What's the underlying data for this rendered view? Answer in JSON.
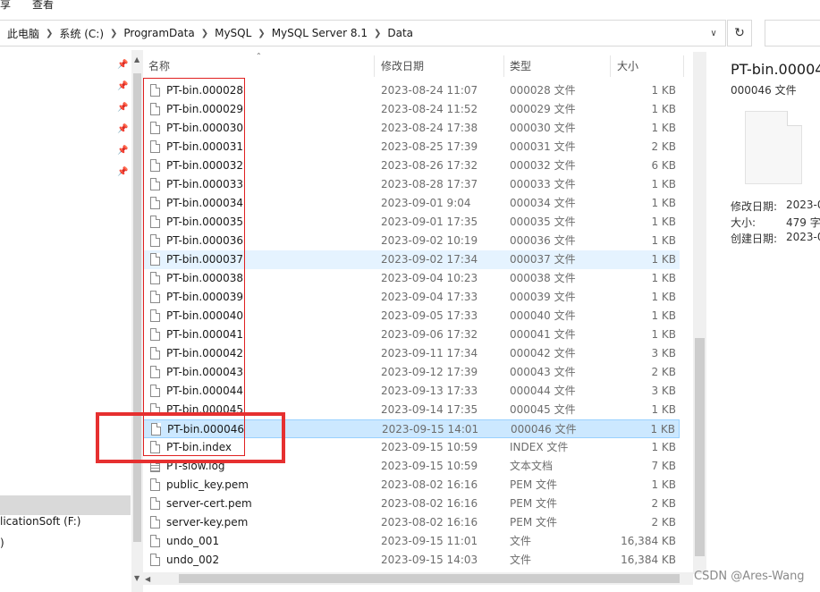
{
  "ribbon": {
    "item_left": "享",
    "item_view": "查看"
  },
  "breadcrumb": [
    "此电脑",
    "系统 (C:)",
    "ProgramData",
    "MySQL",
    "MySQL Server 8.1",
    "Data"
  ],
  "nav": {
    "drive_label": "licationSoft (F:)",
    "drive_label_2": ")"
  },
  "columns": {
    "name": "名称",
    "date": "修改日期",
    "type": "类型",
    "size": "大小"
  },
  "files": [
    {
      "name": "PT-bin.000028",
      "date": "2023-08-24 11:07",
      "type": "000028 文件",
      "size": "1 KB",
      "icon": "file-icon"
    },
    {
      "name": "PT-bin.000029",
      "date": "2023-08-24 11:52",
      "type": "000029 文件",
      "size": "1 KB",
      "icon": "file-icon"
    },
    {
      "name": "PT-bin.000030",
      "date": "2023-08-24 17:38",
      "type": "000030 文件",
      "size": "1 KB",
      "icon": "file-icon"
    },
    {
      "name": "PT-bin.000031",
      "date": "2023-08-25 17:39",
      "type": "000031 文件",
      "size": "2 KB",
      "icon": "file-icon"
    },
    {
      "name": "PT-bin.000032",
      "date": "2023-08-26 17:32",
      "type": "000032 文件",
      "size": "6 KB",
      "icon": "file-icon"
    },
    {
      "name": "PT-bin.000033",
      "date": "2023-08-28 17:37",
      "type": "000033 文件",
      "size": "1 KB",
      "icon": "file-icon"
    },
    {
      "name": "PT-bin.000034",
      "date": "2023-09-01 9:04",
      "type": "000034 文件",
      "size": "1 KB",
      "icon": "file-icon"
    },
    {
      "name": "PT-bin.000035",
      "date": "2023-09-01 17:35",
      "type": "000035 文件",
      "size": "1 KB",
      "icon": "file-icon"
    },
    {
      "name": "PT-bin.000036",
      "date": "2023-09-02 10:19",
      "type": "000036 文件",
      "size": "1 KB",
      "icon": "file-icon"
    },
    {
      "name": "PT-bin.000037",
      "date": "2023-09-02 17:34",
      "type": "000037 文件",
      "size": "1 KB",
      "icon": "file-icon",
      "state": "hover"
    },
    {
      "name": "PT-bin.000038",
      "date": "2023-09-04 10:23",
      "type": "000038 文件",
      "size": "1 KB",
      "icon": "file-icon"
    },
    {
      "name": "PT-bin.000039",
      "date": "2023-09-04 17:33",
      "type": "000039 文件",
      "size": "1 KB",
      "icon": "file-icon"
    },
    {
      "name": "PT-bin.000040",
      "date": "2023-09-05 17:33",
      "type": "000040 文件",
      "size": "1 KB",
      "icon": "file-icon"
    },
    {
      "name": "PT-bin.000041",
      "date": "2023-09-06 17:32",
      "type": "000041 文件",
      "size": "1 KB",
      "icon": "file-icon"
    },
    {
      "name": "PT-bin.000042",
      "date": "2023-09-11 17:34",
      "type": "000042 文件",
      "size": "3 KB",
      "icon": "file-icon"
    },
    {
      "name": "PT-bin.000043",
      "date": "2023-09-12 17:39",
      "type": "000043 文件",
      "size": "2 KB",
      "icon": "file-icon"
    },
    {
      "name": "PT-bin.000044",
      "date": "2023-09-13 17:33",
      "type": "000044 文件",
      "size": "3 KB",
      "icon": "file-icon"
    },
    {
      "name": "PT-bin.000045",
      "date": "2023-09-14 17:35",
      "type": "000045 文件",
      "size": "1 KB",
      "icon": "file-icon"
    },
    {
      "name": "PT-bin.000046",
      "date": "2023-09-15 14:01",
      "type": "000046 文件",
      "size": "1 KB",
      "icon": "file-icon",
      "state": "selected"
    },
    {
      "name": "PT-bin.index",
      "date": "2023-09-15 10:59",
      "type": "INDEX 文件",
      "size": "1 KB",
      "icon": "file-icon"
    },
    {
      "name": "PT-slow.log",
      "date": "2023-09-15 10:59",
      "type": "文本文档",
      "size": "7 KB",
      "icon": "text-file-icon"
    },
    {
      "name": "public_key.pem",
      "date": "2023-08-02 16:16",
      "type": "PEM 文件",
      "size": "1 KB",
      "icon": "file-icon"
    },
    {
      "name": "server-cert.pem",
      "date": "2023-08-02 16:16",
      "type": "PEM 文件",
      "size": "2 KB",
      "icon": "file-icon"
    },
    {
      "name": "server-key.pem",
      "date": "2023-08-02 16:16",
      "type": "PEM 文件",
      "size": "2 KB",
      "icon": "file-icon"
    },
    {
      "name": "undo_001",
      "date": "2023-09-15 11:01",
      "type": "文件",
      "size": "16,384 KB",
      "icon": "file-icon"
    },
    {
      "name": "undo_002",
      "date": "2023-09-15 14:03",
      "type": "文件",
      "size": "16,384 KB",
      "icon": "file-icon"
    }
  ],
  "preview": {
    "title": "PT-bin.00004",
    "subtitle": "000046 文件",
    "modified_label": "修改日期:",
    "modified_value": "2023-0",
    "size_label": "大小:",
    "size_value": "479 字",
    "created_label": "创建日期:",
    "created_value": "2023-0"
  },
  "watermark": "CSDN @Ares-Wang",
  "colors": {
    "hover": "#e5f3ff",
    "selected": "#cce8ff",
    "annotation": "#e02020"
  }
}
